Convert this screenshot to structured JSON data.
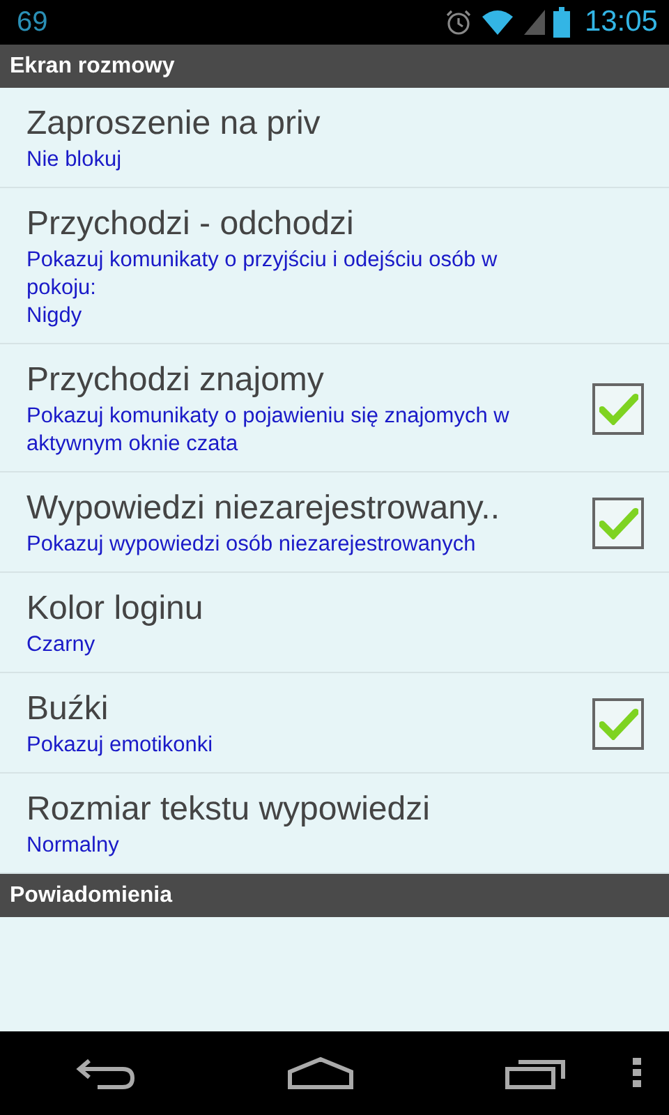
{
  "status_bar": {
    "notification": "69",
    "time": "13:05"
  },
  "sections": [
    {
      "title": "Ekran rozmowy",
      "items": [
        {
          "kind": "list",
          "title": "Zaproszenie na priv",
          "summary": [
            "Nie blokuj"
          ]
        },
        {
          "kind": "list",
          "title": "Przychodzi - odchodzi",
          "summary": [
            "Pokazuj komunikaty o przyjściu i odejściu osób w pokoju:",
            "Nigdy"
          ]
        },
        {
          "kind": "checkbox",
          "title": "Przychodzi znajomy",
          "summary": [
            "Pokazuj komunikaty o pojawieniu się znajomych w aktywnym oknie czata"
          ],
          "checked": true
        },
        {
          "kind": "checkbox",
          "title": "Wypowiedzi niezarejestrowany..",
          "summary": [
            "Pokazuj wypowiedzi osób niezarejestrowanych"
          ],
          "checked": true
        },
        {
          "kind": "list",
          "title": "Kolor loginu",
          "summary": [
            "Czarny"
          ]
        },
        {
          "kind": "checkbox",
          "title": "Buźki",
          "summary": [
            "Pokazuj emotikonki"
          ],
          "checked": true
        },
        {
          "kind": "list",
          "title": "Rozmiar tekstu wypowiedzi",
          "summary": [
            "Normalny"
          ]
        }
      ]
    },
    {
      "title": "Powiadomienia"
    }
  ]
}
